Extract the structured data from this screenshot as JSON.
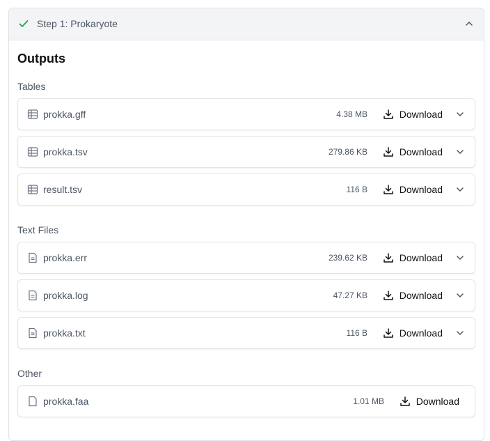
{
  "step": {
    "title": "Step 1: Prokaryote",
    "status_icon": "check-icon",
    "toggle_icon": "chevron-up-icon"
  },
  "outputs_heading": "Outputs",
  "download_label": "Download",
  "sections": [
    {
      "label": "Tables",
      "icon": "table-icon",
      "files": [
        {
          "name": "prokka.gff",
          "size": "4.38 MB"
        },
        {
          "name": "prokka.tsv",
          "size": "279.86 KB"
        },
        {
          "name": "result.tsv",
          "size": "116 B"
        }
      ]
    },
    {
      "label": "Text Files",
      "icon": "text-file-icon",
      "files": [
        {
          "name": "prokka.err",
          "size": "239.62 KB"
        },
        {
          "name": "prokka.log",
          "size": "47.27 KB"
        },
        {
          "name": "prokka.txt",
          "size": "116 B"
        }
      ]
    },
    {
      "label": "Other",
      "icon": "file-icon",
      "files": [
        {
          "name": "prokka.faa",
          "size": "1.01 MB"
        }
      ]
    }
  ],
  "colors": {
    "check": "#22a34a",
    "muted_text": "#4b5563",
    "header_bg": "#f3f4f6"
  }
}
